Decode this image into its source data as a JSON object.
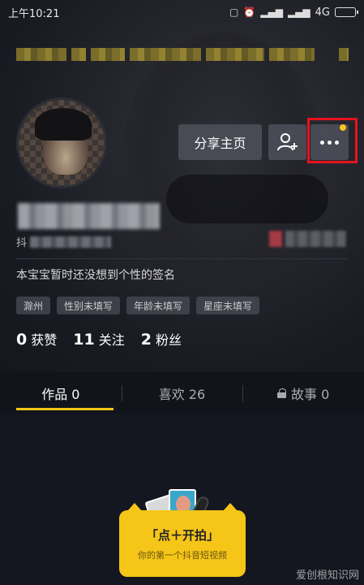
{
  "status_bar": {
    "time": "上午10:21",
    "network": "4G",
    "icons": [
      "notification-icon",
      "alarm-icon",
      "signal-icon",
      "signal-icon"
    ]
  },
  "profile": {
    "share_button": "分享主页",
    "add_friend_icon": "person-add-icon",
    "more_icon": "more-dots-icon",
    "id_prefix": "抖",
    "signature": "本宝宝暂时还没想到个性的签名",
    "tags": [
      "滁州",
      "性别未填写",
      "年龄未填写",
      "星座未填写"
    ],
    "stats": [
      {
        "num": "0",
        "label": "获赞"
      },
      {
        "num": "11",
        "label": "关注"
      },
      {
        "num": "2",
        "label": "粉丝"
      }
    ]
  },
  "tabs": [
    {
      "label": "作品 0",
      "active": true
    },
    {
      "label": "喜欢 26",
      "active": false
    },
    {
      "label": "故事 0",
      "active": false
    }
  ],
  "promo": {
    "title": "「点＋开拍」",
    "subtitle": "你的第一个抖音短视频"
  },
  "watermark": "爱创根知识网",
  "colors": {
    "accent": "#f5c518",
    "highlight": "#e8121e",
    "background": "#141720"
  }
}
